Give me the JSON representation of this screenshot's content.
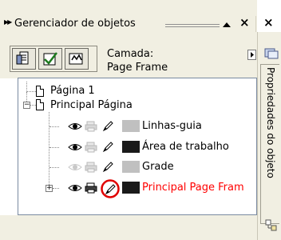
{
  "titlebar": {
    "title": "Gerenciador de objetos",
    "grip_glyph": "▶▶",
    "close_glyph": "×",
    "close2_glyph": "×"
  },
  "toolbar": {
    "layer_label": "Camada:",
    "layer_value": "Page Frame"
  },
  "tree": {
    "page1_label": "Página 1",
    "master_label": "Principal Página",
    "layers": [
      {
        "label": "Linhas-guia",
        "swatch_color": "#c0c0c0",
        "label_color": "#000000",
        "visible": true,
        "printable": false,
        "editable": true
      },
      {
        "label": "Área de trabalho",
        "swatch_color": "#1a1a1a",
        "label_color": "#000000",
        "visible": true,
        "printable": false,
        "editable": true
      },
      {
        "label": "Grade",
        "swatch_color": "#c0c0c0",
        "label_color": "#000000",
        "visible": false,
        "printable": false,
        "editable": true
      },
      {
        "label": "Principal Page Fram",
        "swatch_color": "#1a1a1a",
        "label_color": "#ff0000",
        "visible": true,
        "printable": true,
        "editable": true
      }
    ]
  },
  "side": {
    "tab_label": "Propriedades do objeto"
  },
  "colors": {
    "panel_bg": "#f1efe2",
    "highlight_circle": "#e00000",
    "active_text": "#ff0000"
  }
}
